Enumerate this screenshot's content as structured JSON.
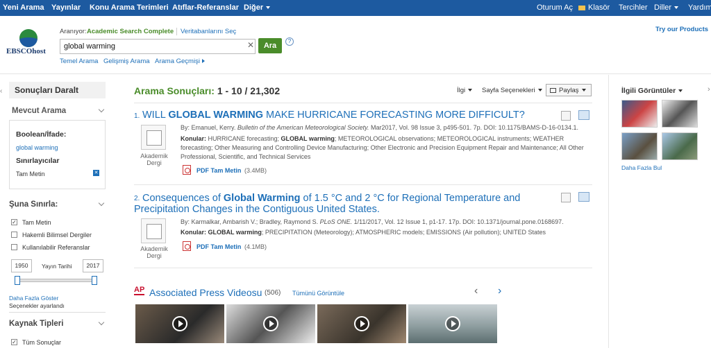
{
  "topnav": {
    "new_search": "Yeni Arama",
    "publications": "Yayınlar",
    "subject_terms": "Konu Arama Terimleri",
    "citations": "Atıflar-Referanslar",
    "more": "Diğer",
    "sign_in": "Oturum Aç",
    "folder": "Klasör",
    "preferences": "Tercihler",
    "languages": "Diller",
    "help": "Yardım"
  },
  "header": {
    "logo_text": "EBSCOhost",
    "searching_label": "Aranıyor:",
    "database": "Academic Search Complete",
    "choose_db": "Veritabanlarını Seç",
    "query": "global warming",
    "search_button": "Ara",
    "help": "?",
    "basic": "Temel Arama",
    "advanced": "Gelişmiş Arama",
    "history": "Arama Geçmişi",
    "try_products": "Try our Products"
  },
  "left": {
    "refine": "Sonuçları Daralt",
    "current": "Mevcut Arama",
    "boolean": "Boolean/İfade:",
    "boolean_value": "global warming",
    "expanders": "Sınırlayıcılar",
    "full_text_tag": "Tam Metin",
    "limit": "Şuna Sınırla:",
    "limit_full_text": "Tam Metin",
    "peer_reviewed": "Hakemli Bilimsel Dergiler",
    "refs": "Kullanılabilir Referanslar",
    "year_from": "1950",
    "year_label": "Yayın Tarihi",
    "year_to": "2017",
    "show_more": "Daha Fazla Göster",
    "options": "Seçenekler ayarlandı",
    "source_types": "Kaynak Tipleri",
    "all_results": "Tüm Sonuçlar"
  },
  "main": {
    "results_label": "Arama Sonuçları:",
    "results_range": "1 - 10 / 21,302",
    "relevance": "İlgi",
    "page_options": "Sayfa Seçenekleri",
    "share": "Paylaş",
    "results": [
      {
        "num": "1.",
        "title_parts": [
          "WILL ",
          "GLOBAL WARMING",
          " MAKE HURRICANE FORECASTING MORE DIFFICULT?"
        ],
        "byline_a": "By: Emanuel, Kerry. ",
        "journal": "Bulletin of the American Meteorological Society.",
        "byline_b": " Mar2017, Vol. 98 Issue 3, p495-501. 7p. DOI: 10.1175/BAMS-D-16-0134.1.",
        "subjects_label": "Konular:",
        "subjects_1": " HURRICANE forecasting; ",
        "subjects_bold": "GLOBAL warming",
        "subjects_2": "; METEOROLOGICAL observations; METEOROLOGICAL instruments; WEATHER",
        "subjects_3": "forecasting; Other Measuring and Controlling Device Manufacturing; Other Electronic and Precision Equipment Repair and Maintenance; All Other",
        "subjects_4": "Professional, Scientific, and Technical Services",
        "type_a": "Akademik",
        "type_b": "Dergi",
        "pdf": "PDF Tam Metin",
        "pdf_size": "(3.4MB)"
      },
      {
        "num": "2.",
        "title_parts": [
          "Consequences of ",
          "Global Warming",
          " of 1.5 °C and 2 °C for Regional Temperature and"
        ],
        "title_line2": "Precipitation Changes in the Contiguous United States.",
        "byline_a": "By: Karmalkar, Ambarish V.; Bradley, Raymond S. ",
        "journal": "PLoS ONE.",
        "byline_b": " 1/11/2017, Vol. 12 Issue 1, p1-17. 17p. DOI: 10.1371/journal.pone.0168697.",
        "subjects_label": "Konular:",
        "subjects_bold": "GLOBAL warming",
        "subjects_2": "; PRECIPITATION (Meteorology); ATMOSPHERIC models; EMISSIONS (Air pollution); UNITED States",
        "type_a": "Akademik",
        "type_b": "Dergi",
        "pdf": "PDF Tam Metin",
        "pdf_size": "(4.1MB)"
      }
    ],
    "ap_logo": "AP",
    "ap_title": "Associated Press Videosu",
    "ap_count": "(506)",
    "view_all": "Tümünü Görüntüle",
    "prev": "‹",
    "next": "›"
  },
  "right": {
    "title": "İlgili Görüntüler",
    "more": "Daha Fazla Bul"
  }
}
